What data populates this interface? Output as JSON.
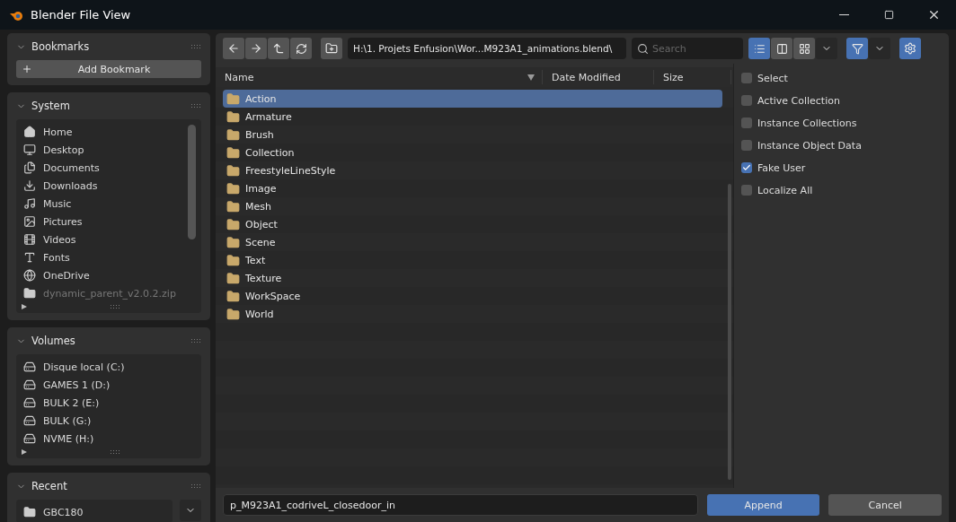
{
  "window": {
    "title": "Blender File View"
  },
  "sidebar": {
    "sections": [
      {
        "title": "Bookmarks",
        "expanded": true,
        "add_button": "Add Bookmark"
      },
      {
        "title": "System",
        "expanded": true,
        "items": [
          {
            "label": "Home",
            "kind": "home",
            "disabled": false
          },
          {
            "label": "Desktop",
            "kind": "desktop",
            "disabled": false
          },
          {
            "label": "Documents",
            "kind": "documents",
            "disabled": false
          },
          {
            "label": "Downloads",
            "kind": "downloads",
            "disabled": false
          },
          {
            "label": "Music",
            "kind": "music",
            "disabled": false
          },
          {
            "label": "Pictures",
            "kind": "pictures",
            "disabled": false
          },
          {
            "label": "Videos",
            "kind": "videos",
            "disabled": false
          },
          {
            "label": "Fonts",
            "kind": "fonts",
            "disabled": false
          },
          {
            "label": "OneDrive",
            "kind": "globe",
            "disabled": false
          },
          {
            "label": "dynamic_parent_v2.0.2.zip",
            "kind": "folder",
            "disabled": true
          }
        ]
      },
      {
        "title": "Volumes",
        "expanded": true,
        "items": [
          {
            "label": "Disque local (C:)",
            "kind": "drive",
            "disabled": false
          },
          {
            "label": "GAMES 1 (D:)",
            "kind": "drive",
            "disabled": false
          },
          {
            "label": "BULK 2 (E:)",
            "kind": "drive",
            "disabled": false
          },
          {
            "label": "BULK (G:)",
            "kind": "drive",
            "disabled": false
          },
          {
            "label": "NVME (H:)",
            "kind": "drive",
            "disabled": false
          }
        ]
      },
      {
        "title": "Recent",
        "expanded": true,
        "items": [
          {
            "label": "GBC180",
            "kind": "folder",
            "disabled": false
          }
        ]
      }
    ]
  },
  "toolbar": {
    "path": "H:\\1. Projets Enfusion\\Wor...M923A1_animations.blend\\",
    "search": {
      "placeholder": "Search"
    },
    "view_modes": [
      {
        "kind": "list",
        "selected": true
      },
      {
        "kind": "columns",
        "selected": false
      },
      {
        "kind": "grid",
        "selected": false
      }
    ],
    "filter": {
      "on": true
    }
  },
  "file_list": {
    "columns": [
      "Name",
      "Date Modified",
      "Size"
    ],
    "rows": [
      {
        "name": "Action",
        "selected": true
      },
      {
        "name": "Armature",
        "selected": false
      },
      {
        "name": "Brush",
        "selected": false
      },
      {
        "name": "Collection",
        "selected": false
      },
      {
        "name": "FreestyleLineStyle",
        "selected": false
      },
      {
        "name": "Image",
        "selected": false
      },
      {
        "name": "Mesh",
        "selected": false
      },
      {
        "name": "Object",
        "selected": false
      },
      {
        "name": "Scene",
        "selected": false
      },
      {
        "name": "Text",
        "selected": false
      },
      {
        "name": "Texture",
        "selected": false
      },
      {
        "name": "WorkSpace",
        "selected": false
      },
      {
        "name": "World",
        "selected": false
      }
    ]
  },
  "options": [
    {
      "label": "Select",
      "checked": false
    },
    {
      "label": "Active Collection",
      "checked": false
    },
    {
      "label": "Instance Collections",
      "checked": false
    },
    {
      "label": "Instance Object Data",
      "checked": false
    },
    {
      "label": "Fake User",
      "checked": true
    },
    {
      "label": "Localize All",
      "checked": false
    }
  ],
  "footer": {
    "filename": "p_M923A1_codriveL_closedoor_in",
    "primary_button": "Append",
    "cancel_button": "Cancel"
  }
}
